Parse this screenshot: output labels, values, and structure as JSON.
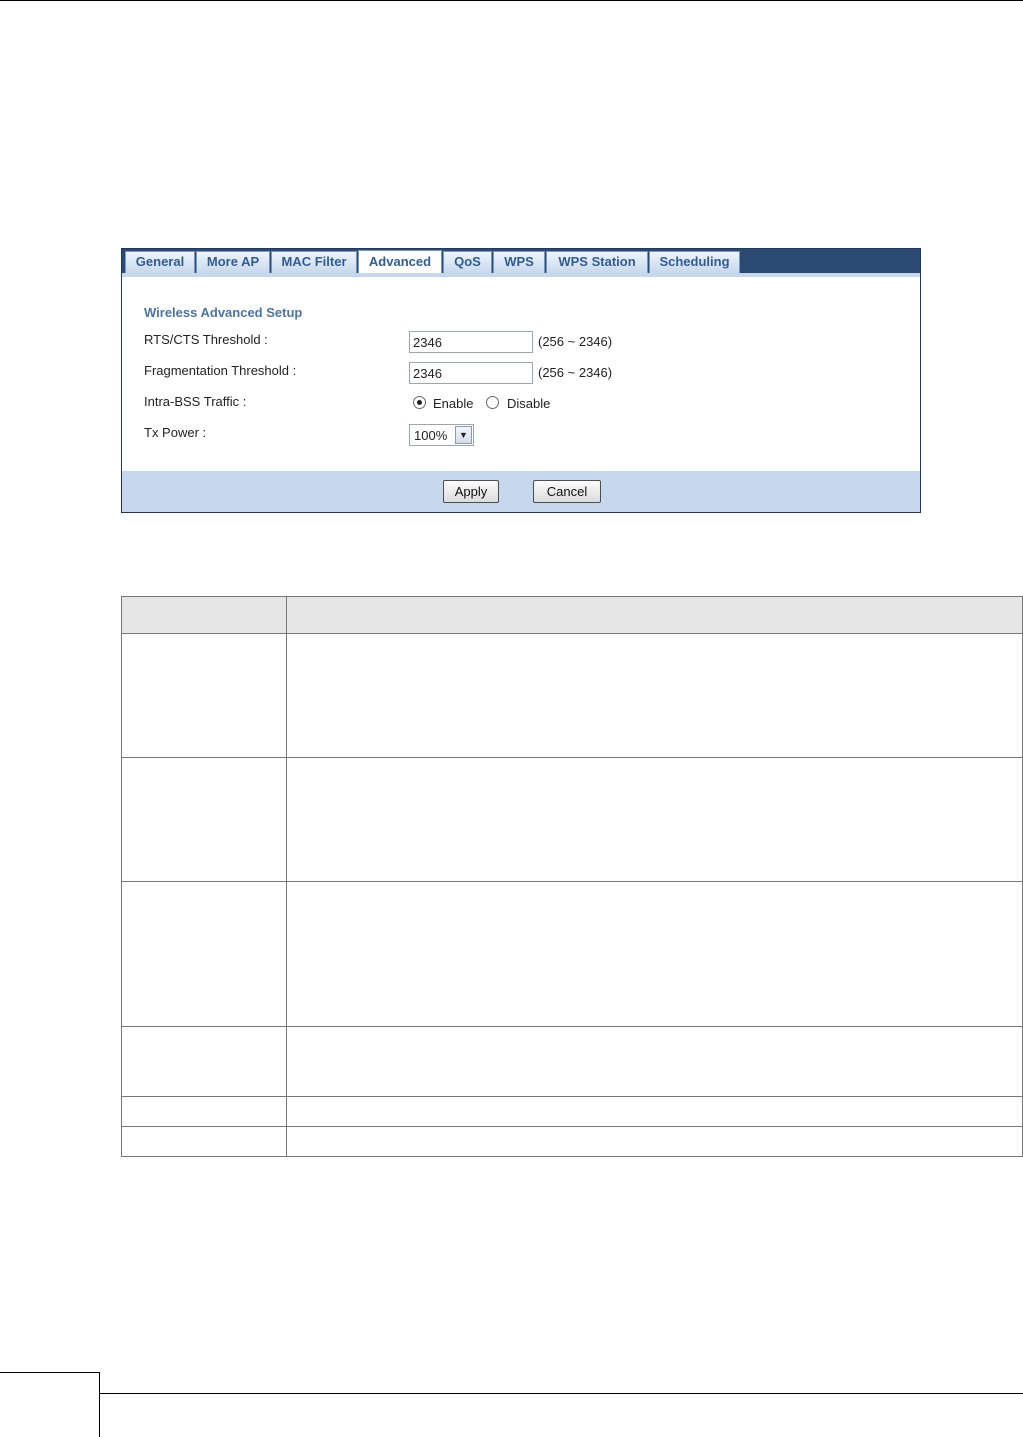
{
  "tabs": [
    {
      "label": "General",
      "active": false
    },
    {
      "label": "More AP",
      "active": false
    },
    {
      "label": "MAC Filter",
      "active": false
    },
    {
      "label": "Advanced",
      "active": true
    },
    {
      "label": "QoS",
      "active": false
    },
    {
      "label": "WPS",
      "active": false
    },
    {
      "label": "WPS Station",
      "active": false
    },
    {
      "label": "Scheduling",
      "active": false
    }
  ],
  "form": {
    "section_title": "Wireless Advanced Setup",
    "rts_label": "RTS/CTS Threshold :",
    "rts_value": "2346",
    "rts_range": "(256 ~ 2346)",
    "frag_label": "Fragmentation Threshold :",
    "frag_value": "2346",
    "frag_range": "(256 ~ 2346)",
    "intra_label": "Intra-BSS Traffic :",
    "intra_enable": "Enable",
    "intra_disable": "Disable",
    "intra_selected": "Enable",
    "tx_label": "Tx Power :",
    "tx_value": "100%"
  },
  "buttons": {
    "apply": "Apply",
    "cancel": "Cancel"
  },
  "colors": {
    "tab_bar": "#2a4a73",
    "tab_text": "#2f5c96",
    "section_title": "#4a74a6",
    "panel_band": "#c6d8ee"
  }
}
